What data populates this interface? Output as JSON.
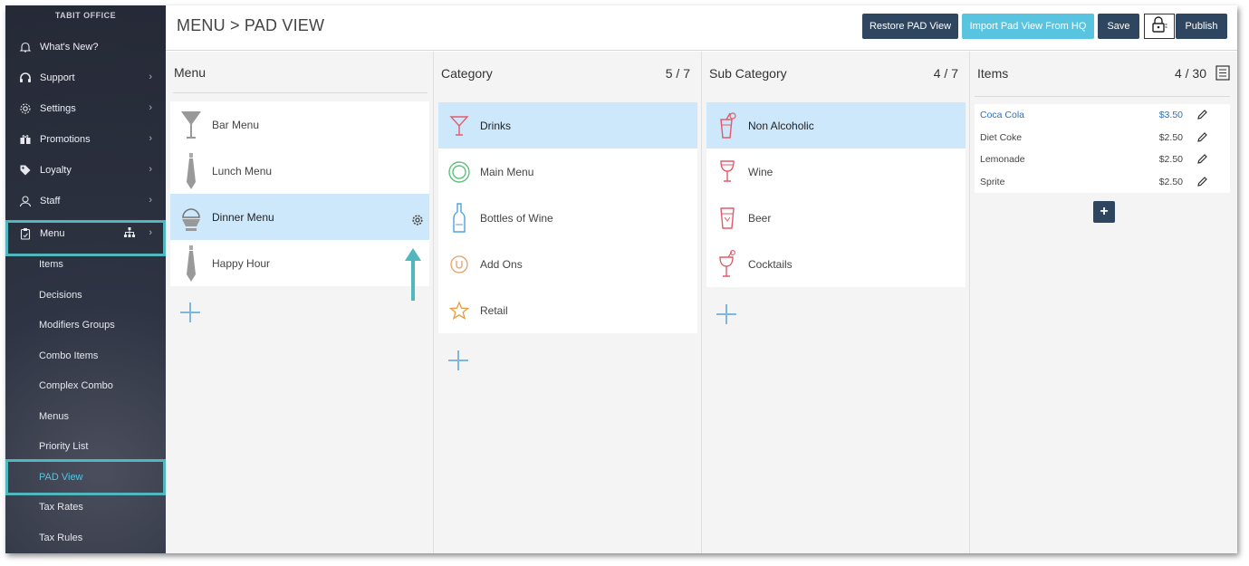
{
  "brand": "TABIT OFFICE",
  "sidebar": {
    "nav": [
      {
        "label": "What's New?",
        "icon": "bell-icon"
      },
      {
        "label": "Support",
        "icon": "headset-icon"
      },
      {
        "label": "Settings",
        "icon": "gear-icon"
      },
      {
        "label": "Promotions",
        "icon": "gift-icon"
      },
      {
        "label": "Loyalty",
        "icon": "tag-icon"
      },
      {
        "label": "Staff",
        "icon": "user-icon"
      },
      {
        "label": "Menu",
        "icon": "clipboard-icon"
      }
    ],
    "sub": [
      "Items",
      "Decisions",
      "Modifiers Groups",
      "Combo Items",
      "Complex Combo",
      "Menus",
      "Priority List",
      "PAD View",
      "Tax Rates",
      "Tax Rules"
    ],
    "active_sub": "PAD View"
  },
  "header": {
    "title": "MENU > PAD VIEW",
    "buttons": {
      "restore": "Restore PAD View",
      "import": "Import Pad View From HQ",
      "save": "Save",
      "publish": "Publish"
    }
  },
  "columns": {
    "menu": {
      "title": "Menu",
      "rows": [
        {
          "label": "Bar Menu",
          "icon": "cocktail-glass-icon"
        },
        {
          "label": "Lunch Menu",
          "icon": "necktie-icon"
        },
        {
          "label": "Dinner Menu",
          "icon": "cloche-icon",
          "selected": true
        },
        {
          "label": "Happy Hour",
          "icon": "necktie-icon"
        }
      ]
    },
    "category": {
      "title": "Category",
      "count": "5 / 7",
      "rows": [
        {
          "label": "Drinks",
          "icon": "martini-icon",
          "selected": true
        },
        {
          "label": "Main Menu",
          "icon": "plate-icon"
        },
        {
          "label": "Bottles of Wine",
          "icon": "bottle-icon"
        },
        {
          "label": "Add Ons",
          "icon": "circle-u-icon"
        },
        {
          "label": "Retail",
          "icon": "star-icon"
        }
      ]
    },
    "subcategory": {
      "title": "Sub Category",
      "count": "4 / 7",
      "rows": [
        {
          "label": "Non Alcoholic",
          "icon": "soda-cup-icon",
          "selected": true
        },
        {
          "label": "Wine",
          "icon": "wine-glass-icon"
        },
        {
          "label": "Beer",
          "icon": "beer-glass-icon"
        },
        {
          "label": "Cocktails",
          "icon": "cocktail-icon"
        }
      ]
    },
    "items": {
      "title": "Items",
      "count": "4 / 30",
      "rows": [
        {
          "name": "Coca Cola",
          "price": "$3.50"
        },
        {
          "name": "Diet Coke",
          "price": "$2.50"
        },
        {
          "name": "Lemonade",
          "price": "$2.50"
        },
        {
          "name": "Sprite",
          "price": "$2.50"
        }
      ]
    }
  },
  "colors": {
    "sidebar_bg": "#2a2f3d",
    "highlight_teal": "#4fb7bd",
    "selected_row": "#cde8fb",
    "primary_button": "#2f4660",
    "import_button": "#58c4e0"
  }
}
